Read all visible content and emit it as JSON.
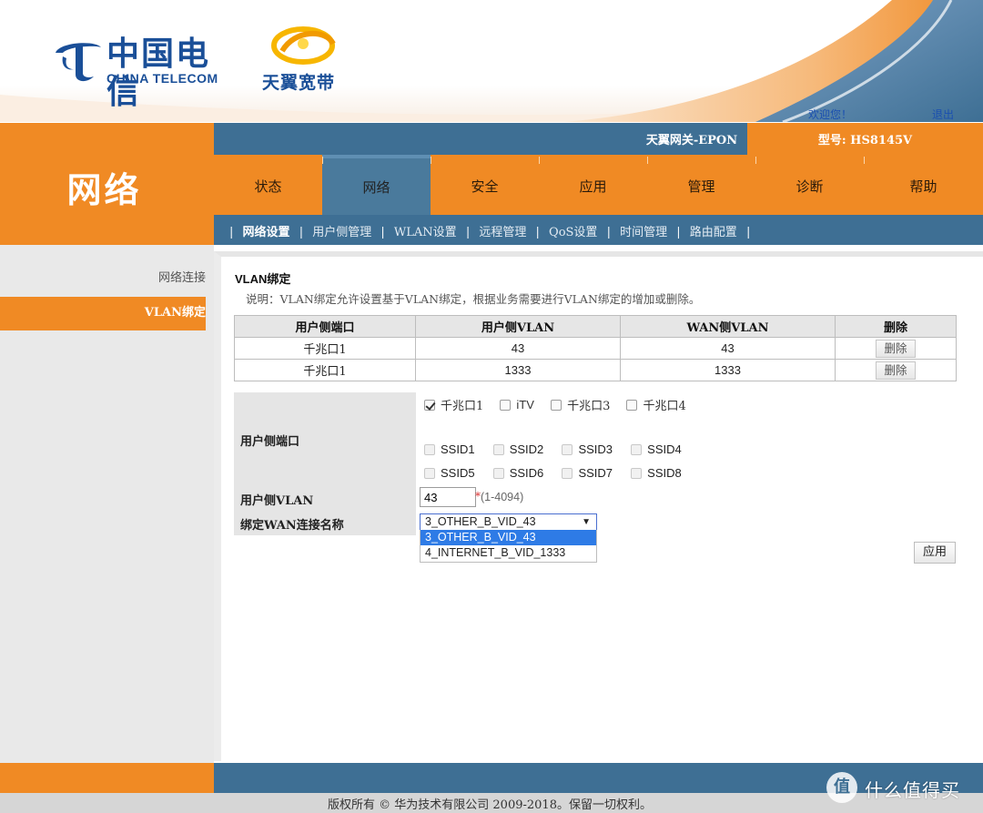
{
  "header": {
    "logo_cn": "中国电信",
    "logo_en": "CHINA TELECOM",
    "brand": "天翼宽带",
    "welcome": "欢迎您！",
    "logout": "退出"
  },
  "infobar": {
    "device_name": "天翼网关-EPON",
    "model": "型号: HS8145V"
  },
  "section_title": "网络",
  "main_nav": [
    {
      "label": "状态",
      "active": false
    },
    {
      "label": "网络",
      "active": true
    },
    {
      "label": "安全",
      "active": false
    },
    {
      "label": "应用",
      "active": false
    },
    {
      "label": "管理",
      "active": false
    },
    {
      "label": "诊断",
      "active": false
    },
    {
      "label": "帮助",
      "active": false
    }
  ],
  "sub_nav": [
    {
      "label": "网络设置",
      "active": true
    },
    {
      "label": "用户侧管理",
      "active": false
    },
    {
      "label": "WLAN设置",
      "active": false
    },
    {
      "label": "远程管理",
      "active": false
    },
    {
      "label": "QoS设置",
      "active": false
    },
    {
      "label": "时间管理",
      "active": false
    },
    {
      "label": "路由配置",
      "active": false
    }
  ],
  "sidebar": {
    "items": [
      {
        "label": "网络连接",
        "active": false
      },
      {
        "label": "VLAN绑定",
        "active": true
      }
    ]
  },
  "content": {
    "title": "VLAN绑定",
    "description": "说明：VLAN绑定允许设置基于VLAN绑定，根据业务需要进行VLAN绑定的增加或删除。",
    "table": {
      "headers": [
        "用户侧端口",
        "用户侧VLAN",
        "WAN侧VLAN",
        "删除"
      ],
      "rows": [
        {
          "port": "千兆口1",
          "user_vlan": "43",
          "wan_vlan": "43",
          "action": "删除"
        },
        {
          "port": "千兆口1",
          "user_vlan": "1333",
          "wan_vlan": "1333",
          "action": "删除"
        }
      ]
    },
    "form": {
      "port_label": "用户侧端口",
      "ports": [
        {
          "label": "千兆口1",
          "checked": true
        },
        {
          "label": "iTV",
          "checked": false
        },
        {
          "label": "千兆口3",
          "checked": false
        },
        {
          "label": "千兆口4",
          "checked": false
        }
      ],
      "ssids_row1": [
        "SSID1",
        "SSID2",
        "SSID3",
        "SSID4"
      ],
      "ssids_row2": [
        "SSID5",
        "SSID6",
        "SSID7",
        "SSID8"
      ],
      "vlan_label": "用户侧VLAN",
      "vlan_value": "43",
      "vlan_required": "*",
      "vlan_range": "(1-4094)",
      "wan_label": "绑定WAN连接名称",
      "wan_selected": "3_OTHER_B_VID_43",
      "wan_options": [
        "3_OTHER_B_VID_43",
        "4_INTERNET_B_VID_1333"
      ],
      "apply_label": "应用"
    }
  },
  "footer": {
    "copyright": "版权所有 © 华为技术有限公司 2009-2018。保留一切权利。",
    "watermark": "什么值得买",
    "watermark_icon": "值"
  },
  "colors": {
    "orange": "#f08a24",
    "blue": "#3e6f94",
    "logo_blue": "#1a4f98"
  }
}
